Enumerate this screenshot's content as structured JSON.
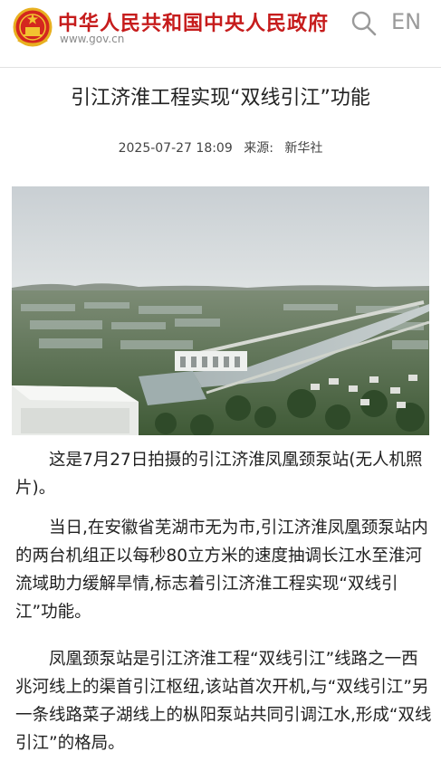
{
  "header": {
    "site_name": "中华人民共和国中央人民政府",
    "site_url": "www.gov.cn",
    "lang_label": "EN",
    "brand_color": "#c61c1c",
    "icons": [
      "national-emblem-icon",
      "search-icon"
    ]
  },
  "article": {
    "title": "引江济淮工程实现“双线引江”功能",
    "date": "2025-07-27 18:09",
    "source_label": "来源:",
    "source": "新华社",
    "paragraphs": [
      "这是7月27日拍摄的引江济淮凤凰颈泵站(无人机照片)。",
      "当日,在安徽省芜湖市无为市,引江济淮凤凰颈泵站内的两台机组正以每秒80立方米的速度抽调长江水至淮河流域助力缓解旱情,标志着引江济淮工程实现“双线引江”功能。",
      "凤凰颈泵站是引江济淮工程“双线引江”线路之一西兆河线上的渠首引江枢纽,该站首次开机,与“双线引江”另一条线路菜子湖线上的枞阳泵站共同引调江水,形成“双线引江”的格局。"
    ]
  }
}
